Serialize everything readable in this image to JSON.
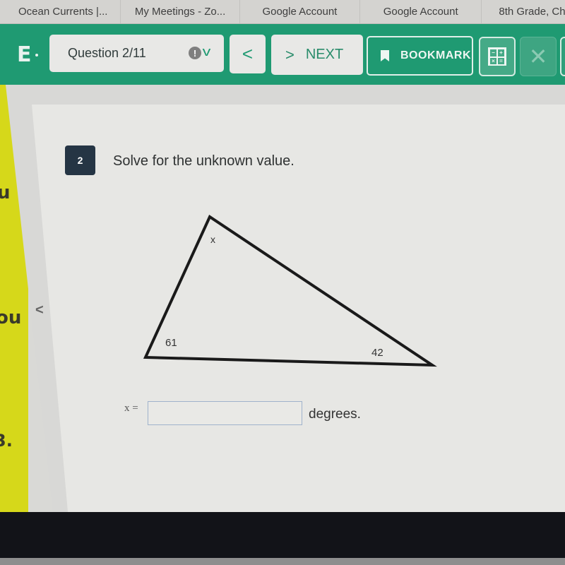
{
  "browser": {
    "bookmarks": [
      "Ocean Currents |...",
      "My Meetings - Zo...",
      "Google Account",
      "Google Account",
      "8th Grade, Ch"
    ]
  },
  "toolbar": {
    "logo_letter": "E",
    "question_selector": "Question 2/11",
    "alert_glyph": "!",
    "dropdown_glyph": "v",
    "prev_glyph": "<",
    "next_glyph": ">",
    "next_label": "NEXT",
    "bookmark_label": "BOOKMARK",
    "calculator_keys": [
      "−",
      "+",
      "×",
      "="
    ],
    "close_glyph": "✕"
  },
  "background": {
    "yellow_fragments": [
      "u",
      "ou",
      "3."
    ],
    "side_prev_glyph": "<"
  },
  "question": {
    "number": "2",
    "prompt": "Solve for the unknown value.",
    "diagram": {
      "type": "triangle",
      "angles": {
        "top": "x",
        "bottom_left": "61",
        "bottom_right": "42"
      }
    },
    "answer": {
      "lhs": "x =",
      "value": "",
      "placeholder": "",
      "unit": "degrees."
    }
  }
}
